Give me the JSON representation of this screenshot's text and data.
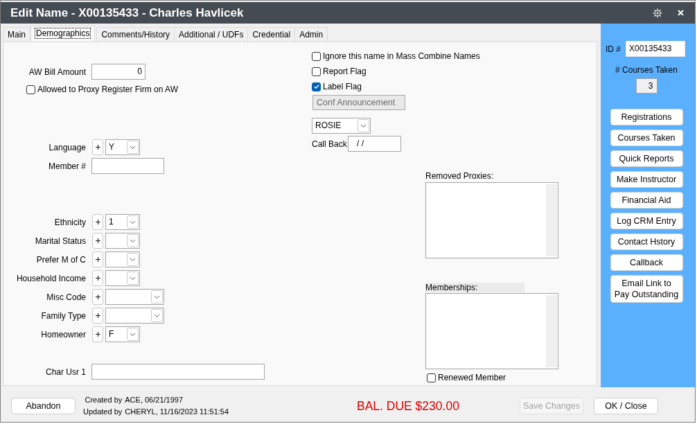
{
  "window": {
    "title": "Edit Name - X00135433 - Charles Havlicek"
  },
  "tabs": [
    {
      "label": "Main",
      "selected": false
    },
    {
      "label": "Demographics",
      "selected": true
    },
    {
      "label": "Comments/History",
      "selected": false
    },
    {
      "label": "Additional / UDFs",
      "selected": false
    },
    {
      "label": "Credential",
      "selected": false
    },
    {
      "label": "Admin",
      "selected": false
    }
  ],
  "demographics": {
    "left_sections": [
      {
        "fields": [
          {
            "kind": "amount",
            "label": "AW Bill Amount",
            "value": "0"
          },
          {
            "kind": "checkbox",
            "label": "Allowed to Proxy Register Firm on AW",
            "checked": false
          }
        ]
      },
      {
        "fields": [
          {
            "kind": "code",
            "label": "Language",
            "value": "Y"
          },
          {
            "kind": "text",
            "label": "Member #"
          }
        ]
      },
      {
        "fields": [
          {
            "kind": "code",
            "label": "Ethnicity",
            "value": "1"
          },
          {
            "kind": "code",
            "label": "Marital Status"
          },
          {
            "kind": "code",
            "label": "Prefer M of C"
          },
          {
            "kind": "code",
            "label": "Household Income"
          },
          {
            "kind": "widecode",
            "label": "Misc Code"
          },
          {
            "kind": "widecode",
            "label": "Family Type"
          },
          {
            "kind": "code",
            "label": "Homeowner",
            "value": "F"
          }
        ]
      },
      {
        "fields": [
          {
            "kind": "longtext",
            "label": "Char Usr 1"
          }
        ]
      }
    ],
    "flags": [
      {
        "label": "Ignore this name in Mass Combine Names",
        "checked": false
      },
      {
        "label": "Report Flag",
        "checked": false
      },
      {
        "label": "Label Flag",
        "checked": true
      }
    ],
    "label_type": {
      "value": "Conf Announcement",
      "disabled": true
    },
    "user": {
      "value": "ROSIE"
    },
    "call_back": {
      "label": "Call Back",
      "value": "/ /"
    },
    "lists": [
      {
        "label": "Removed Proxies:"
      },
      {
        "label": "Memberships:"
      }
    ],
    "renewed_member": {
      "label": "Renewed Member",
      "checked": false
    }
  },
  "side_panel": {
    "id": {
      "label": "ID #",
      "value": "X00135433"
    },
    "courses_taken": {
      "label": "# Courses Taken",
      "value": "3"
    },
    "buttons": [
      "Registrations",
      "Courses Taken",
      "Quick Reports",
      "Make Instructor",
      "Financial Aid",
      "Log CRM Entry",
      "Contact Hstory",
      "Callback",
      "Email Link to Pay Outstanding"
    ]
  },
  "footer": {
    "abandon": "Abandon",
    "audit": [
      {
        "label": "Created by",
        "value": "ACE, 06/21/1997"
      },
      {
        "label": "Updated by",
        "value": "CHERYL, 11/16/2023 11:51:54"
      }
    ],
    "balance": "BAL. DUE $230.00",
    "save": {
      "label": "Save Changes",
      "disabled": true
    },
    "ok": {
      "label": "OK / Close",
      "disabled": false
    }
  }
}
